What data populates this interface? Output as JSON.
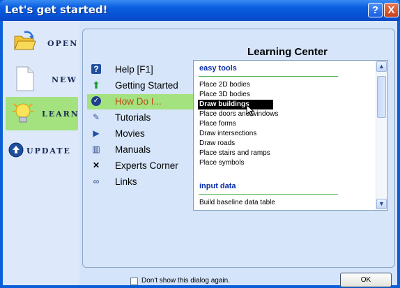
{
  "window": {
    "title": "Let's get started!"
  },
  "title_buttons": {
    "help": "?",
    "close": "X"
  },
  "left_panel": [
    {
      "label": "OPEN",
      "icon": "open-folder-icon"
    },
    {
      "label": "NEW",
      "icon": "new-document-icon"
    },
    {
      "label": "LEARN",
      "icon": "lightbulb-icon",
      "active": true
    },
    {
      "label": "UPDATE",
      "icon": "update-arrow-icon"
    }
  ],
  "learning_center": {
    "title": "Learning Center",
    "menu": [
      {
        "label": "Help [F1]",
        "icon": "help-icon"
      },
      {
        "label": "Getting Started",
        "icon": "up-arrow-icon"
      },
      {
        "label": "How Do I...",
        "icon": "checkmark-icon",
        "selected": true
      },
      {
        "label": "Tutorials",
        "icon": "pencil-icon"
      },
      {
        "label": "Movies",
        "icon": "play-icon"
      },
      {
        "label": "Manuals",
        "icon": "book-icon"
      },
      {
        "label": "Experts Corner",
        "icon": "x-icon"
      },
      {
        "label": "Links",
        "icon": "link-icon"
      }
    ],
    "list": {
      "sections": [
        {
          "title": "easy tools",
          "items": [
            "Place 2D bodies",
            "Place 3D bodies",
            "Draw buildings",
            "Place doors and windows",
            "Place forms",
            "Draw intersections",
            "Draw roads",
            "Place stairs and ramps",
            "Place symbols"
          ]
        },
        {
          "title": "input data",
          "items": [
            "Build baseline data table"
          ]
        }
      ],
      "highlighted": "Draw buildings"
    }
  },
  "footer": {
    "checkbox_label": "Don't show this dialog again.",
    "ok_label": "OK"
  },
  "colors": {
    "title_blue": "#0a5fd8",
    "selected_green": "#a3e27f",
    "selected_text": "#c24a12",
    "section_blue": "#0a2ea8"
  }
}
